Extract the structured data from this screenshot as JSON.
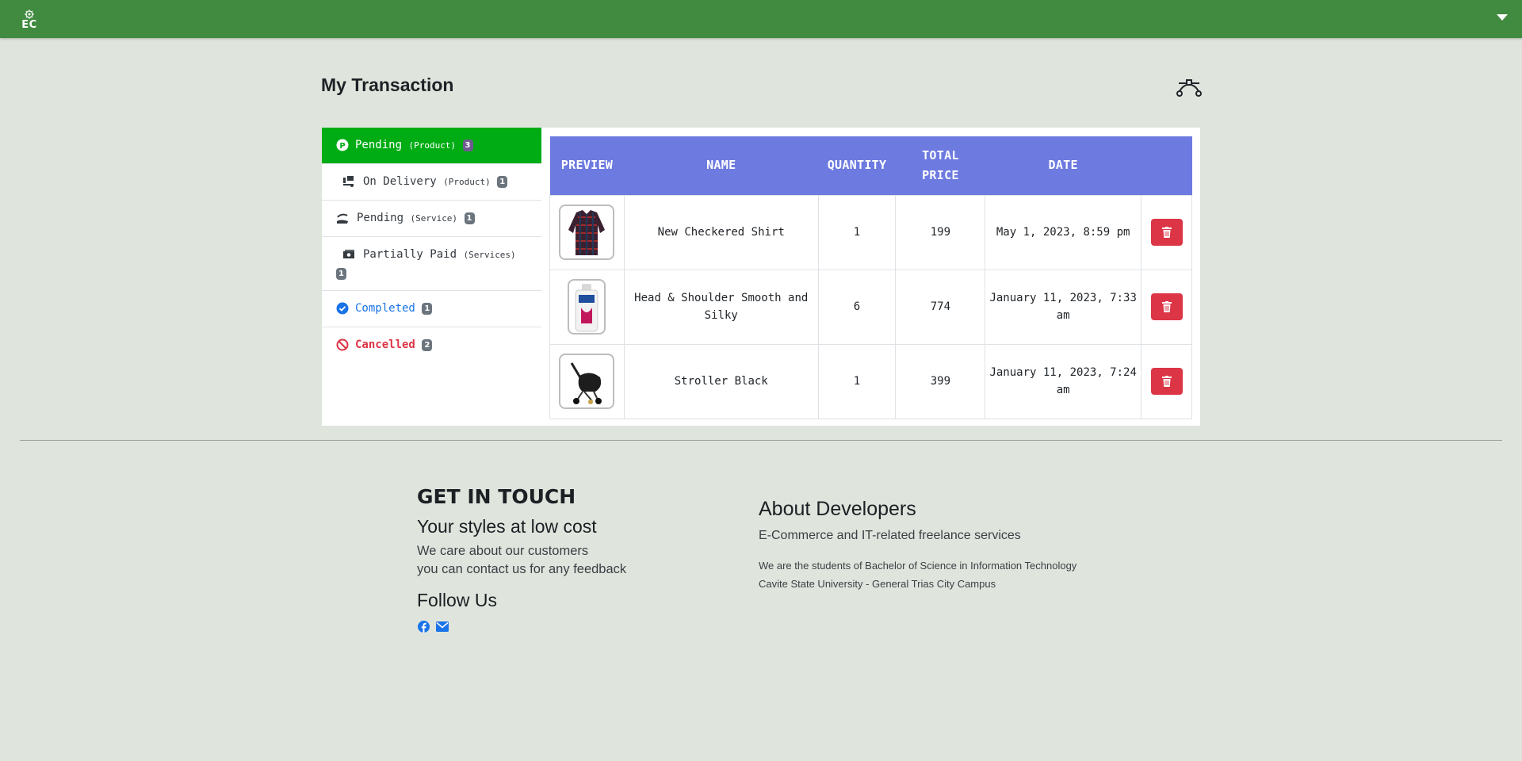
{
  "brand": {
    "logo_text": "EC",
    "color": "#418b41"
  },
  "page": {
    "title": "My Transaction"
  },
  "sidebar": {
    "items": [
      {
        "label": "Pending",
        "sub": "(Product)",
        "count": "3",
        "icon": "pending-p-icon",
        "state": "active"
      },
      {
        "label": "On Delivery",
        "sub": "(Product)",
        "count": "1",
        "icon": "delivery-icon"
      },
      {
        "label": "Pending",
        "sub": "(Service)",
        "count": "1",
        "icon": "hand-holding-icon"
      },
      {
        "label": "Partially Paid",
        "sub": "(Services)",
        "count": "1",
        "icon": "money-icon"
      },
      {
        "label": "Completed",
        "count": "1",
        "icon": "check-circle-icon"
      },
      {
        "label": "Cancelled",
        "count": "2",
        "icon": "ban-icon"
      }
    ]
  },
  "table": {
    "headers": {
      "preview": "PREVIEW",
      "name": "NAME",
      "quantity": "QUANTITY",
      "total_price_1": "TOTAL",
      "total_price_2": "PRICE",
      "date": "DATE"
    },
    "rows": [
      {
        "name": "New Checkered Shirt",
        "quantity": "1",
        "total": "199",
        "date": "May 1, 2023, 8:59 pm",
        "image": "checkered-shirt-image"
      },
      {
        "name": "Head & Shoulder Smooth and Silky",
        "quantity": "6",
        "total": "774",
        "date": "January 11, 2023, 7:33 am",
        "image": "shampoo-bottle-image"
      },
      {
        "name": "Stroller Black",
        "quantity": "1",
        "total": "399",
        "date": "January 11, 2023, 7:24 am",
        "image": "stroller-image"
      }
    ]
  },
  "footer": {
    "contact": {
      "heading": "GET IN TOUCH",
      "tagline": "Your styles at low cost",
      "line1": "We care about our customers",
      "line2": "you can contact us for any feedback",
      "follow": "Follow Us",
      "icons": [
        "facebook-icon",
        "envelope-icon"
      ]
    },
    "about": {
      "heading": "About Developers",
      "sub": "E-Commerce and IT-related freelance services",
      "line1": "We are the students of Bachelor of Science in Information Technology",
      "line2": "Cavite State University - General Trias City Campus"
    }
  },
  "colors": {
    "table_header": "#6d7ae0",
    "active_tab": "#00ac14",
    "delete": "#dc3545",
    "completed": "#1a73e8",
    "cancelled": "#dc3545"
  }
}
